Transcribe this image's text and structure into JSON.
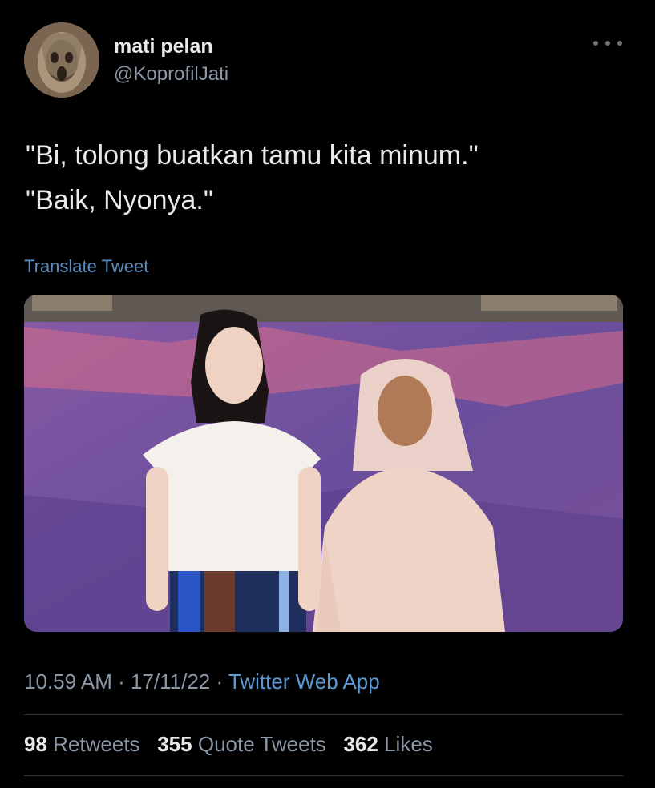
{
  "user": {
    "display_name": "mati pelan",
    "handle": "@KoprofilJati"
  },
  "tweet": {
    "text": "\"Bi, tolong buatkan tamu kita minum.\"\n\"Baik, Nyonya.\"",
    "translate_label": "Translate Tweet"
  },
  "meta": {
    "time": "10.59 AM",
    "date": "17/11/22",
    "app": "Twitter Web App"
  },
  "stats": {
    "retweets_count": "98",
    "retweets_label": "Retweets",
    "quotes_count": "355",
    "quotes_label": "Quote Tweets",
    "likes_count": "362",
    "likes_label": "Likes"
  },
  "colors": {
    "background": "#000000",
    "link": "#5b9ad5",
    "muted": "#8b98a5"
  }
}
